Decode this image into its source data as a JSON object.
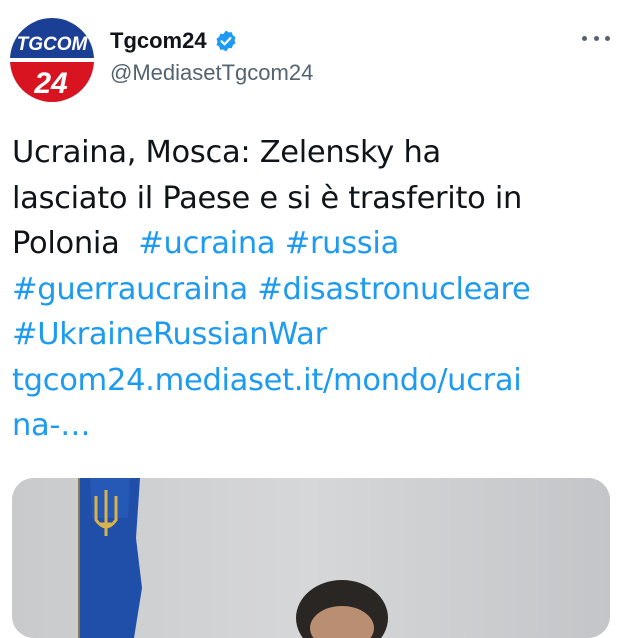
{
  "author": {
    "name": "Tgcom24",
    "handle": "@MediasetTgcom24",
    "verified": true,
    "avatar": {
      "logo_text_top": "TGCOM",
      "logo_text_bottom": "24",
      "colors": {
        "top": "#1a3f95",
        "bottom": "#d7141f"
      }
    }
  },
  "more_icon": "more-horizontal-icon",
  "tweet": {
    "line1": "Ucraina, Mosca: Zelensky ha",
    "line2": "lasciato il Paese e si è trasferito in",
    "line3_text": "Polonia",
    "hashtags": {
      "ucraina": "#ucraina",
      "russia": "#russia",
      "guerraucraina": "#guerraucraina",
      "disastronucleare": "#disastronucleare",
      "ukrainerussianwar": "#UkraineRussianWar"
    },
    "link_line1": "tgcom24.mediaset.it/mondo/ucrai",
    "link_line2": "na-…"
  },
  "colors": {
    "accent": "#1d9bf0",
    "text": "#0f1419",
    "secondary": "#536471"
  }
}
